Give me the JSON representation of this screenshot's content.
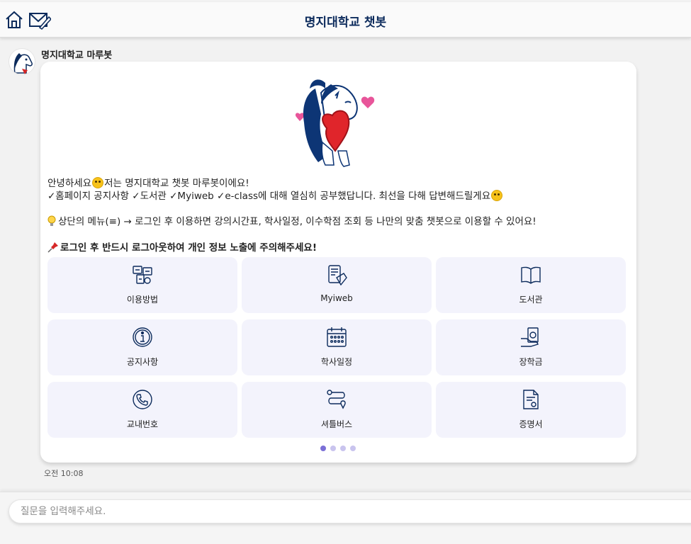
{
  "header": {
    "title": "명지대학교 챗봇",
    "home_icon": "home-icon",
    "mail_icon": "mail-edit-icon"
  },
  "bot": {
    "name": "명지대학교 마루봇",
    "avatar_icon": "horse-mascot-icon"
  },
  "message": {
    "line1_a": "안녕하세요",
    "line1_b": "저는 명지대학교 챗봇 마루봇이에요!",
    "line2": "✓홈페이지 공지사항 ✓도서관 ✓Myiweb ✓e-class에 대해 열심히 공부했답니다. 최선을 다해 답변해드릴게요",
    "line3": "상단의 메뉴(≡) → 로그인 후 이용하면 강의시간표, 학사일정, 이수학점 조회 등 나만의 맞춤 챗봇으로 이용할 수 있어요!",
    "line4": "로그인 후 반드시 로그아웃하여 개인 정보 노출에 주의해주세요!",
    "timestamp": "오전 10:08"
  },
  "menu": [
    {
      "label": "이용방법",
      "icon": "usage-guide-icon"
    },
    {
      "label": "Myiweb",
      "icon": "myiweb-icon"
    },
    {
      "label": "도서관",
      "icon": "book-icon"
    },
    {
      "label": "공지사항",
      "icon": "info-icon"
    },
    {
      "label": "학사일정",
      "icon": "calendar-icon"
    },
    {
      "label": "장학금",
      "icon": "money-hand-icon"
    },
    {
      "label": "교내번호",
      "icon": "phone-icon"
    },
    {
      "label": "셔틀버스",
      "icon": "route-icon"
    },
    {
      "label": "증명서",
      "icon": "certificate-icon"
    }
  ],
  "pagination": {
    "pages": 4,
    "current": 1
  },
  "input": {
    "placeholder": "질문을 입력해주세요."
  },
  "colors": {
    "accent": "#0c2b5c",
    "tile_bg": "#f3f3fc",
    "dot_active": "#7b6fd6",
    "dot_inactive": "#c9c4ee"
  }
}
